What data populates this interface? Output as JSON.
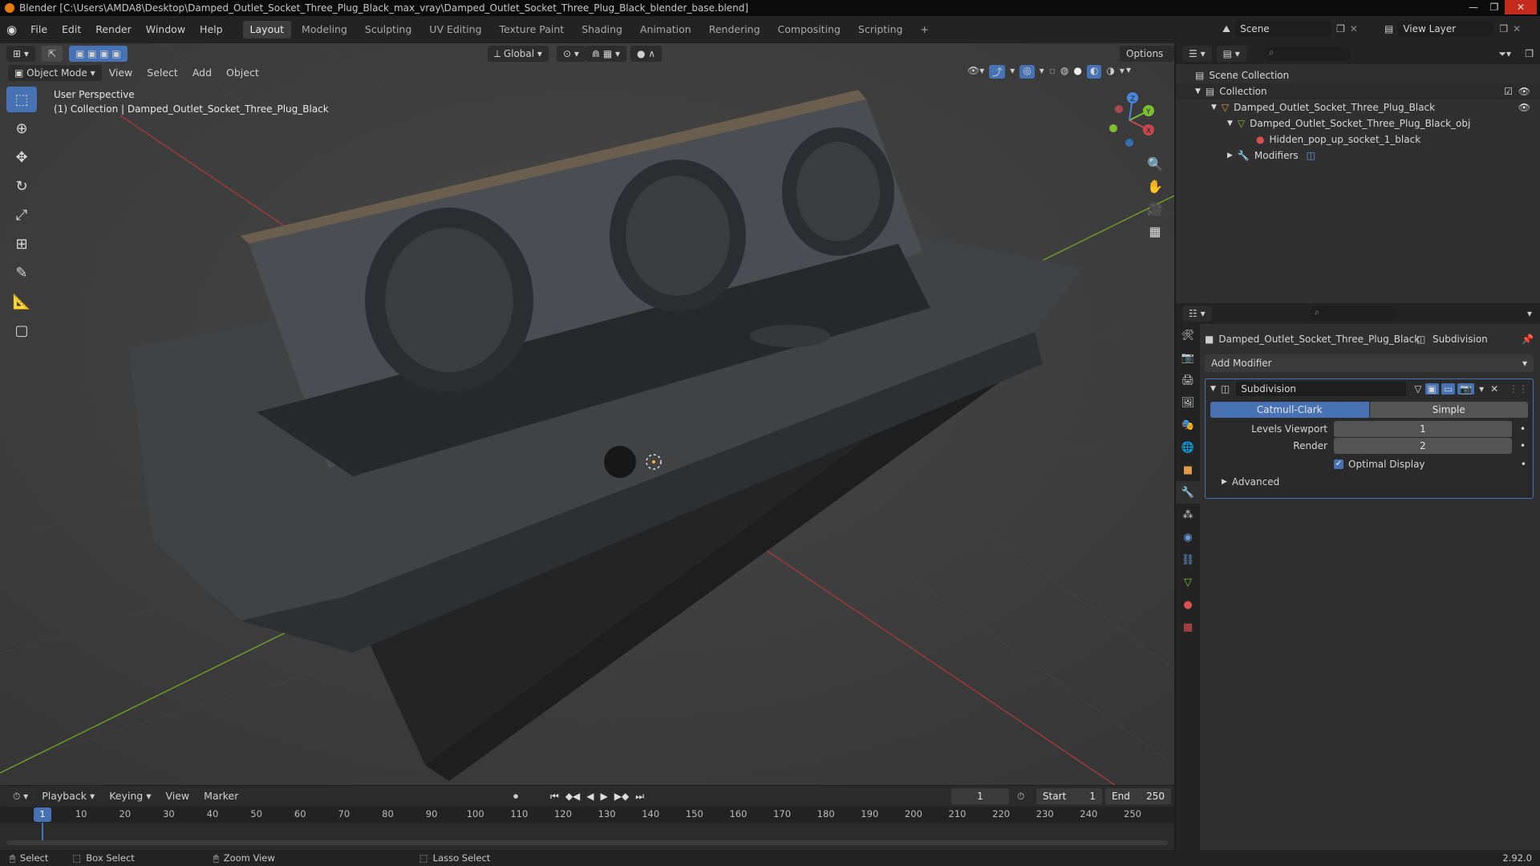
{
  "window": {
    "title": "Blender [C:\\Users\\AMDA8\\Desktop\\Damped_Outlet_Socket_Three_Plug_Black_max_vray\\Damped_Outlet_Socket_Three_Plug_Black_blender_base.blend]"
  },
  "menus": [
    "File",
    "Edit",
    "Render",
    "Window",
    "Help"
  ],
  "workspaces": [
    "Layout",
    "Modeling",
    "Sculpting",
    "UV Editing",
    "Texture Paint",
    "Shading",
    "Animation",
    "Rendering",
    "Compositing",
    "Scripting",
    "+"
  ],
  "topbar": {
    "scene": "Scene",
    "view_layer": "View Layer"
  },
  "viewport": {
    "orientation": "Global",
    "options": "Options",
    "mode": "Object Mode",
    "menus": [
      "View",
      "Select",
      "Add",
      "Object"
    ],
    "overlay_line1": "User Perspective",
    "overlay_line2": "(1) Collection | Damped_Outlet_Socket_Three_Plug_Black",
    "gizmo": {
      "x": "X",
      "y": "Y",
      "z": "Z"
    }
  },
  "outliner": {
    "rows": [
      {
        "label": "Scene Collection"
      },
      {
        "label": "Collection"
      },
      {
        "label": "Damped_Outlet_Socket_Three_Plug_Black"
      },
      {
        "label": "Damped_Outlet_Socket_Three_Plug_Black_obj"
      },
      {
        "label": "Hidden_pop_up_socket_1_black"
      },
      {
        "label": "Modifiers"
      }
    ]
  },
  "properties": {
    "object_name": "Damped_Outlet_Socket_Three_Plug_Black",
    "modifier_tab": "Subdivision",
    "add_modifier": "Add Modifier",
    "modifier": {
      "name": "Subdivision",
      "type_a": "Catmull-Clark",
      "type_b": "Simple",
      "levels_viewport_label": "Levels Viewport",
      "levels_viewport": "1",
      "render_label": "Render",
      "render": "2",
      "optimal_display": "Optimal Display",
      "advanced": "Advanced"
    }
  },
  "timeline": {
    "menus": [
      "Playback",
      "Keying",
      "View",
      "Marker"
    ],
    "current_frame": "1",
    "start_label": "Start",
    "start": "1",
    "end_label": "End",
    "end": "250",
    "ticks": [
      "1",
      "10",
      "20",
      "30",
      "40",
      "50",
      "60",
      "70",
      "80",
      "90",
      "100",
      "110",
      "120",
      "130",
      "140",
      "150",
      "160",
      "170",
      "180",
      "190",
      "200",
      "210",
      "220",
      "230",
      "240",
      "250"
    ]
  },
  "statusbar": {
    "select": "Select",
    "box_select": "Box Select",
    "zoom_view": "Zoom View",
    "lasso_select": "Lasso Select",
    "version": "2.92.0"
  },
  "colors": {
    "accent": "#4772b3",
    "x_axis": "#c8474f",
    "y_axis": "#7fbf2e",
    "z_axis": "#4a86d9"
  }
}
